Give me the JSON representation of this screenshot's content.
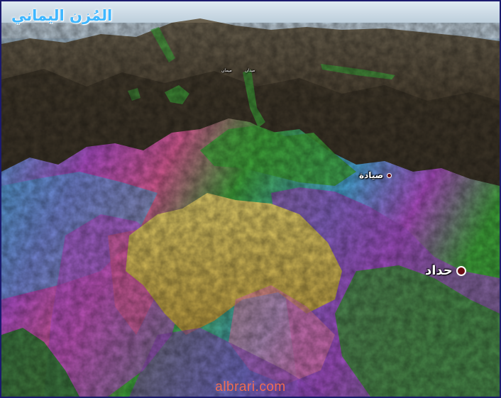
{
  "header": {
    "title": "المُزن اليماني"
  },
  "places": [
    {
      "key": "maydan-1",
      "label": "ميمان"
    },
    {
      "key": "maydan-2",
      "label": "ميدان"
    },
    {
      "key": "sayada",
      "label": "صيادة"
    },
    {
      "key": "haddad",
      "label": "حداد"
    }
  ],
  "watermark": {
    "text": "albrari.com"
  },
  "colors": {
    "sky": "#9fb6c8",
    "terrain_brown": "#4d4432",
    "green": "#3fa53a",
    "yellow": "#d4bd55",
    "magenta": "#b04ec8",
    "blue": "#4aa7d9",
    "pink": "#d45a92",
    "title": "#3fb7ff",
    "pin": "#6b0d12",
    "watermark": "#ff6f4a"
  }
}
